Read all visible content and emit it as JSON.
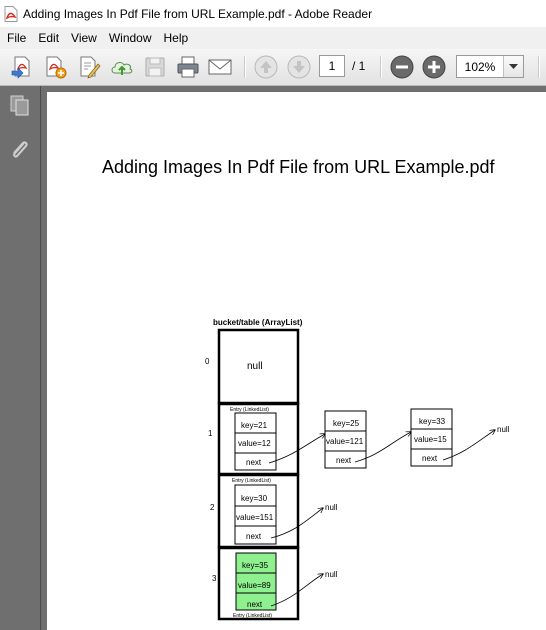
{
  "window": {
    "title": "Adding Images In Pdf File from URL Example.pdf - Adobe Reader"
  },
  "menu": {
    "items": [
      "File",
      "Edit",
      "View",
      "Window",
      "Help"
    ]
  },
  "toolbar": {
    "page_current": "1",
    "page_total": "/ 1",
    "zoom": "102%"
  },
  "document": {
    "title": "Adding Images In Pdf File from URL Example.pdf"
  },
  "figure": {
    "table_label": "bucket/table (ArrayList)",
    "indices": [
      "0",
      "1",
      "2",
      "3"
    ],
    "null_text": "null",
    "entry_label": "Entry (LinkedList)",
    "bucket1": {
      "key": "key=21",
      "value": "value=12",
      "next": "next",
      "chain": [
        {
          "key": "key=25",
          "value": "value=121",
          "next": "next"
        },
        {
          "key": "key=33",
          "value": "value=15",
          "next": "next"
        }
      ],
      "end": "null"
    },
    "bucket2": {
      "key": "key=30",
      "value": "value=151",
      "next": "next",
      "end": "null"
    },
    "bucket3": {
      "key": "key=35",
      "value": "value=89",
      "next": "next",
      "end": "null"
    },
    "highlight_color": "#8ef08e"
  }
}
